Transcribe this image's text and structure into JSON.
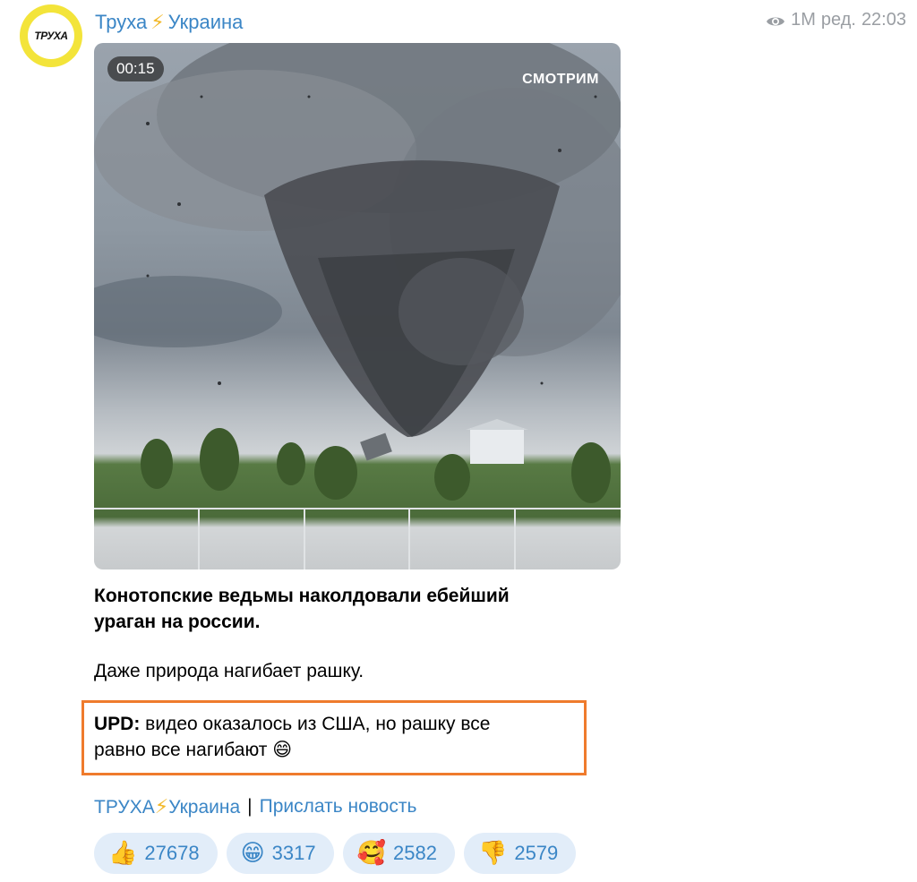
{
  "channel": {
    "avatar_text": "ТРУХА",
    "name": "Труха",
    "name_bolt": "⚡",
    "name_suffix": "Украина"
  },
  "post_meta": {
    "views": "1M",
    "edited": "ред.",
    "time": "22:03"
  },
  "video": {
    "duration": "00:15",
    "watermark": "СМОТРИМ"
  },
  "post": {
    "title_line1": "Конотопские ведьмы наколдовали ебейший",
    "title_line2": "ураган на россии.",
    "body": "Даже природа нагибает рашку.",
    "upd_label": "UPD:",
    "upd_line1": " видео оказалось из США, но рашку все",
    "upd_line2": "равно все нагибают",
    "upd_emoji": "😄"
  },
  "footer_links": {
    "channel_link_part1": "ТРУХА",
    "channel_link_bolt": "⚡",
    "channel_link_part2": "Украина",
    "separator": "|",
    "submit_link": "Прислать новость"
  },
  "reactions": [
    {
      "emoji": "👍",
      "icon": "thumbs-up-icon",
      "count": "27678"
    },
    {
      "emoji": "😁",
      "icon": "grin-icon",
      "count": "3317"
    },
    {
      "emoji": "🥰",
      "icon": "smiling-hearts-icon",
      "count": "2582"
    },
    {
      "emoji": "👎",
      "icon": "thumbs-down-icon",
      "count": "2579"
    }
  ],
  "colors": {
    "link": "#3b86c6",
    "highlight_border": "#ef7b2d",
    "reaction_bg": "#e2edf9",
    "avatar_ring": "#f3e43a"
  }
}
